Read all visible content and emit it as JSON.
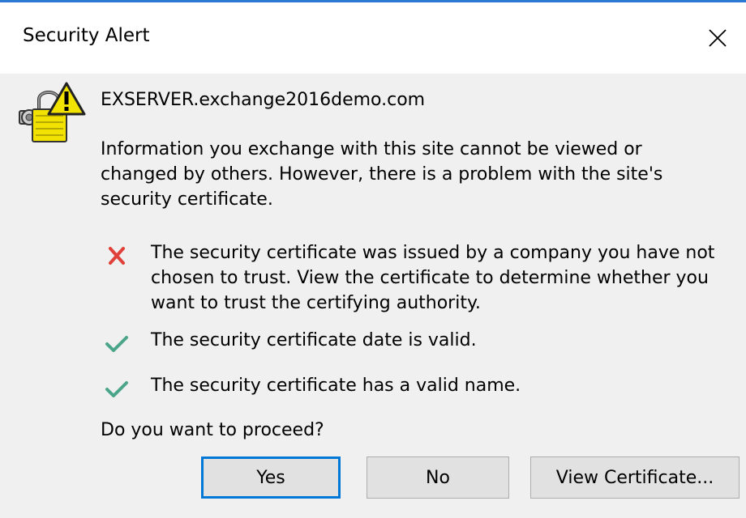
{
  "titlebar": {
    "title": "Security Alert",
    "close_icon": "close-icon"
  },
  "content": {
    "server_name": "EXSERVER.exchange2016demo.com",
    "info": "Information you exchange with this site cannot be viewed or changed by others. However, there is a problem with the site's security certificate.",
    "checks": [
      {
        "status": "fail",
        "icon": "red-x-icon",
        "text": "The security certificate was issued by a company you have not chosen to trust. View the certificate to determine whether you want to trust the certifying authority."
      },
      {
        "status": "pass",
        "icon": "green-check-icon",
        "text": "The security certificate date is valid."
      },
      {
        "status": "pass",
        "icon": "green-check-icon",
        "text": "The security certificate has a valid name."
      }
    ],
    "question": "Do you want to proceed?"
  },
  "buttons": {
    "yes": "Yes",
    "no": "No",
    "view_certificate": "View Certificate..."
  },
  "colors": {
    "accent": "#0078d7",
    "title_border": "#2b79d0",
    "fail": "#e0413a",
    "pass": "#4aa589",
    "lock_yellow": "#f2e200"
  }
}
